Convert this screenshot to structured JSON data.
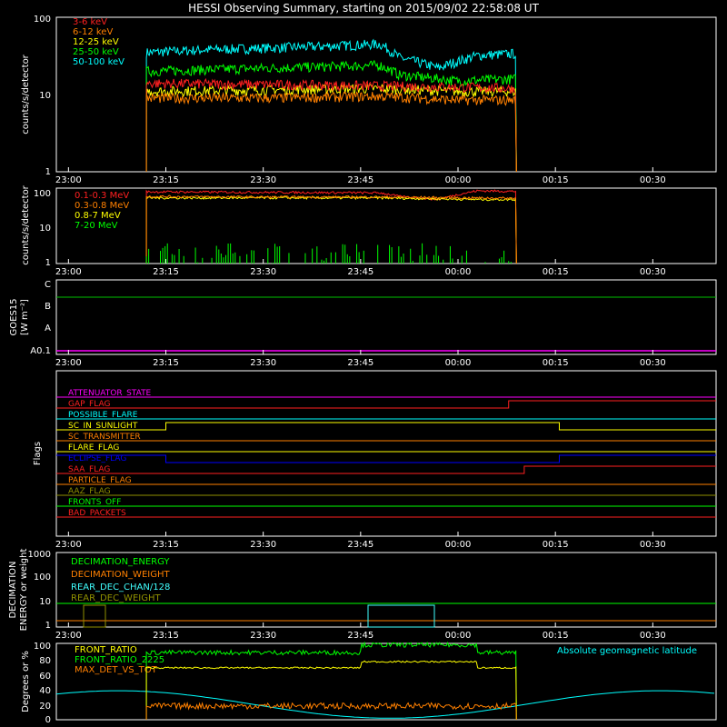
{
  "title": "HESSI Observing Summary, starting on 2015/09/02 22:58:08 UT",
  "colors": {
    "frame": "#ffffff",
    "magenta": "#ff00ff",
    "red": "#ff2020",
    "cyan": "#00ffff",
    "yellow": "#ffff00",
    "orange": "#ff8000",
    "blue": "#0000ff",
    "green": "#00ff00",
    "olive": "#909000",
    "green_dim": "#00c000",
    "cyan_light": "#40ffff"
  },
  "time_ticks": [
    "23:00",
    "23:15",
    "23:30",
    "23:45",
    "00:00",
    "00:15",
    "00:30"
  ],
  "chart_data": [
    {
      "type": "line",
      "panel": "low-energy",
      "ylabel": "counts/s/detector",
      "yscale": "log",
      "ylim": [
        1,
        100
      ],
      "yticks": [
        "1",
        "10",
        "100"
      ],
      "legend": [
        "3-6 keV",
        "6-12 keV",
        "12-25 keV",
        "25-50 keV",
        "50-100 keV"
      ],
      "series": [
        {
          "name": "50-100 keV",
          "color": "cyan",
          "segments": [
            [
              [
                23.2,
                35
              ],
              [
                23.35,
                38
              ],
              [
                23.5,
                40
              ],
              [
                23.65,
                42
              ],
              [
                23.8,
                45
              ],
              [
                23.85,
                30
              ],
              [
                23.95,
                22
              ],
              [
                24.05,
                32
              ],
              [
                24.15,
                34
              ]
            ]
          ]
        },
        {
          "name": "25-50 keV",
          "color": "green",
          "segments": [
            [
              [
                23.2,
                20
              ],
              [
                23.35,
                21
              ],
              [
                23.5,
                22
              ],
              [
                23.65,
                23
              ],
              [
                23.8,
                24
              ],
              [
                23.85,
                18
              ],
              [
                24.0,
                15
              ],
              [
                24.15,
                16
              ]
            ]
          ]
        },
        {
          "name": "12-25 keV",
          "color": "yellow",
          "segments": [
            [
              [
                23.2,
                11
              ],
              [
                23.5,
                11.5
              ],
              [
                23.8,
                12
              ],
              [
                24.0,
                11
              ],
              [
                24.15,
                11
              ]
            ]
          ]
        },
        {
          "name": "3-6 keV",
          "color": "red",
          "segments": [
            [
              [
                23.2,
                14
              ],
              [
                23.5,
                13.5
              ],
              [
                23.8,
                13
              ],
              [
                24.0,
                12.5
              ],
              [
                24.15,
                12
              ]
            ]
          ]
        },
        {
          "name": "6-12 keV",
          "color": "orange",
          "segments": [
            [
              [
                23.2,
                9
              ],
              [
                23.5,
                9
              ],
              [
                23.8,
                9.5
              ],
              [
                24.0,
                8.5
              ],
              [
                24.15,
                8.5
              ]
            ]
          ]
        }
      ],
      "range": [
        23.2,
        24.15
      ]
    },
    {
      "type": "line",
      "panel": "high-energy",
      "ylabel": "counts/s/detector",
      "yscale": "log",
      "ylim": [
        1,
        100
      ],
      "yticks": [
        "1",
        "10",
        "100"
      ],
      "legend": [
        "0.1-0.3 MeV",
        "0.3-0.8 MeV",
        "0.8-7 MeV",
        "7-20 MeV"
      ],
      "series": [
        {
          "name": "0.1-0.3 MeV",
          "color": "red",
          "segments": [
            [
              [
                23.2,
                80
              ],
              [
                23.8,
                75
              ],
              [
                23.85,
                60
              ],
              [
                23.95,
                50
              ],
              [
                24.05,
                85
              ],
              [
                24.15,
                82
              ]
            ]
          ]
        },
        {
          "name": "0.3-0.8 MeV",
          "color": "yellow",
          "segments": [
            [
              [
                23.2,
                55
              ],
              [
                23.5,
                55
              ],
              [
                23.8,
                55
              ],
              [
                24.05,
                50
              ],
              [
                24.15,
                50
              ]
            ]
          ]
        },
        {
          "name": "0.8-7 MeV",
          "color": "orange",
          "segments": [
            [
              [
                23.2,
                60
              ],
              [
                23.5,
                58
              ],
              [
                23.8,
                58
              ],
              [
                24.05,
                55
              ],
              [
                24.15,
                54
              ]
            ]
          ]
        }
      ],
      "range": [
        23.2,
        24.15
      ]
    },
    {
      "type": "line",
      "panel": "goes",
      "ylabel": "GOES15",
      "ylabel2": "[W m⁻²]",
      "yticks": [
        "A0.1",
        "A",
        "B",
        "C"
      ],
      "series": [
        {
          "name": "",
          "color": "green_dim",
          "value": "B+"
        }
      ]
    },
    {
      "type": "line",
      "panel": "flags",
      "ylabel": "Flags",
      "flags": [
        {
          "name": "ATTENUATOR_STATE",
          "color": "magenta",
          "steps": []
        },
        {
          "name": "GAP_FLAG",
          "color": "red",
          "steps": [
            [
              24.13,
              1
            ]
          ]
        },
        {
          "name": "POSSIBLE_FLARE",
          "color": "cyan",
          "steps": []
        },
        {
          "name": "SC_IN_SUNLIGHT",
          "color": "yellow",
          "steps": [
            [
              23.25,
              1
            ],
            [
              24.26,
              0
            ]
          ]
        },
        {
          "name": "SC_TRANSMITTER",
          "color": "orange",
          "steps": []
        },
        {
          "name": "FLARE_FLAG",
          "color": "yellow",
          "steps": []
        },
        {
          "name": "ECLIPSE_FLAG",
          "color": "blue",
          "steps": [
            [
              23.25,
              0
            ],
            [
              24.26,
              1
            ]
          ]
        },
        {
          "name": "SAA_FLAG",
          "color": "red",
          "steps": [
            [
              24.17,
              1
            ]
          ]
        },
        {
          "name": "PARTICLE_FLAG",
          "color": "orange",
          "steps": []
        },
        {
          "name": "AAZ_FLAG",
          "color": "olive",
          "steps": []
        },
        {
          "name": "FRONTS_OFF",
          "color": "green",
          "steps": []
        },
        {
          "name": "BAD_PACKETS",
          "color": "red",
          "steps": []
        }
      ]
    },
    {
      "type": "line",
      "panel": "decimation",
      "ylabel": "DECIMATION",
      "ylabel2": "ENERGY or weight",
      "yscale": "log",
      "ylim": [
        1,
        1000
      ],
      "yticks": [
        "1",
        "10",
        "100",
        "1000"
      ],
      "legend": [
        "DECIMATION_ENERGY",
        "DECIMATION_WEIGHT",
        "REAR_DEC_CHAN/128",
        "REAR_DEC_WEIGHT"
      ]
    },
    {
      "type": "line",
      "panel": "ratio",
      "ylabel": "Degrees or %",
      "ylim": [
        0,
        100
      ],
      "yticks": [
        "0",
        "20",
        "40",
        "60",
        "80",
        "100"
      ],
      "legend": [
        "FRONT_RATIO",
        "FRONT_RATIO_2225",
        "MAX_DET_VS_TOT"
      ],
      "legend_right": "Absolute geomagnetic latitude"
    }
  ]
}
